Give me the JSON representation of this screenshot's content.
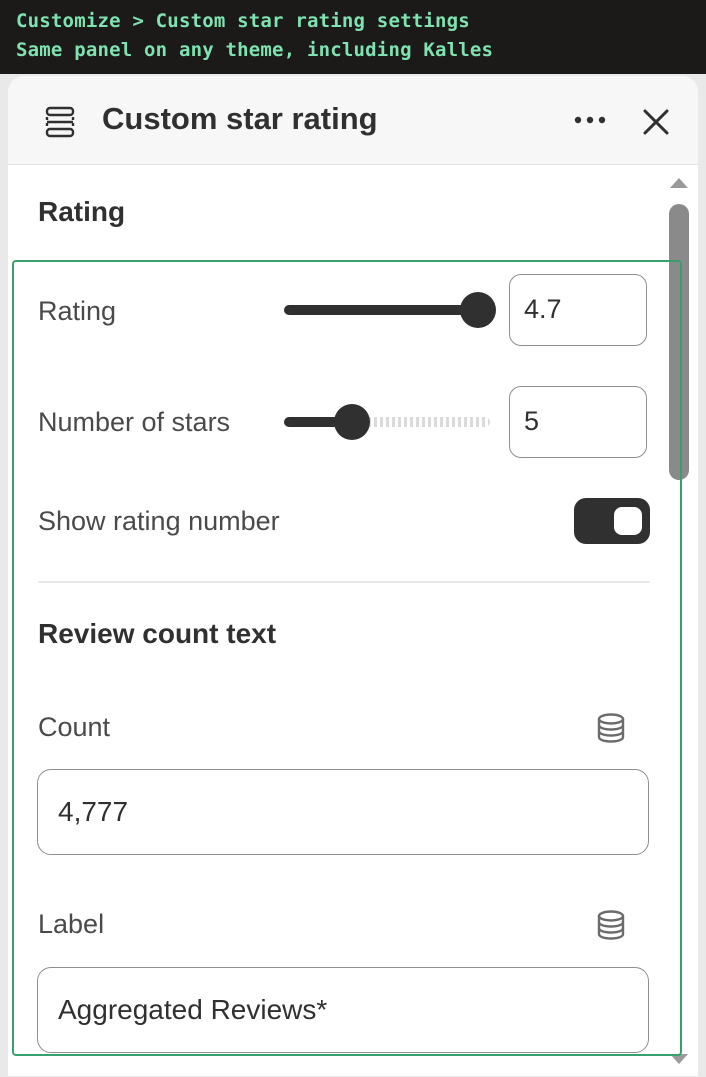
{
  "caption": {
    "line1": "Customize > Custom star rating settings",
    "line2": "Same panel on any theme, including Kalles"
  },
  "panel": {
    "title": "Custom star rating",
    "header_icon": "block-section-icon",
    "more_icon": "more-horizontal-icon",
    "close_icon": "close-icon"
  },
  "rating_section": {
    "title": "Rating",
    "rating": {
      "label": "Rating",
      "value": "4.7",
      "slider_fraction": 0.94
    },
    "number_of_stars": {
      "label": "Number of stars",
      "value": "5",
      "slider_fraction": 0.33
    },
    "show_rating_number": {
      "label": "Show rating number",
      "checked": true
    }
  },
  "review_section": {
    "title": "Review count text",
    "count": {
      "label": "Count",
      "value": "4,777",
      "icon": "dynamic-source-database-icon"
    },
    "label_field": {
      "label": "Label",
      "value": "Aggregated Reviews*",
      "icon": "dynamic-source-database-icon"
    }
  },
  "colors": {
    "caption_bg": "#1c1a18",
    "caption_text": "#7ee3b1",
    "highlight_border": "#37a06c",
    "control_dark": "#303030"
  }
}
